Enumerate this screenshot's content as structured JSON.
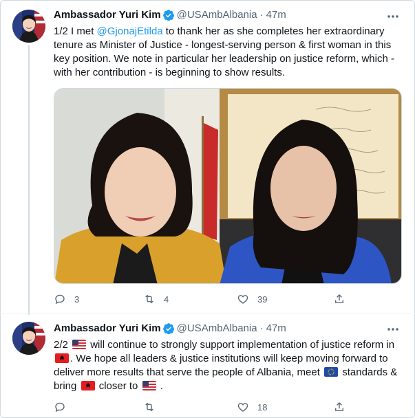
{
  "tweets": [
    {
      "author_name": "Ambassador Yuri Kim",
      "handle": "@USAmbAlbania",
      "separator": "·",
      "time": "47m",
      "text_prefix": "1/2 I met ",
      "mention": "@GjonajEtilda",
      "text_suffix": " to thank her as she completes her extraordinary tenure as Minister of Justice - longest-serving person & first woman in this key position. We note in particular her leadership on justice reform, which - with her contribution - is beginning to show results.",
      "replies": "3",
      "retweets": "4",
      "likes": "39"
    },
    {
      "author_name": "Ambassador Yuri Kim",
      "handle": "@USAmbAlbania",
      "separator": "·",
      "time": "47m",
      "seg1": "2/2 ",
      "seg2": " will continue to strongly support implementation of justice reform in ",
      "seg3": ". We hope all leaders & justice institutions will keep moving forward to deliver more results that serve the people of Albania, meet ",
      "seg4": " standards & bring ",
      "seg5": " closer to ",
      "seg6": " .",
      "replies": "",
      "retweets": "",
      "likes": "18"
    }
  ],
  "colors": {
    "accent": "#1d9bf0",
    "text": "#0f1419",
    "muted": "#536471",
    "border": "#cfd9de"
  }
}
